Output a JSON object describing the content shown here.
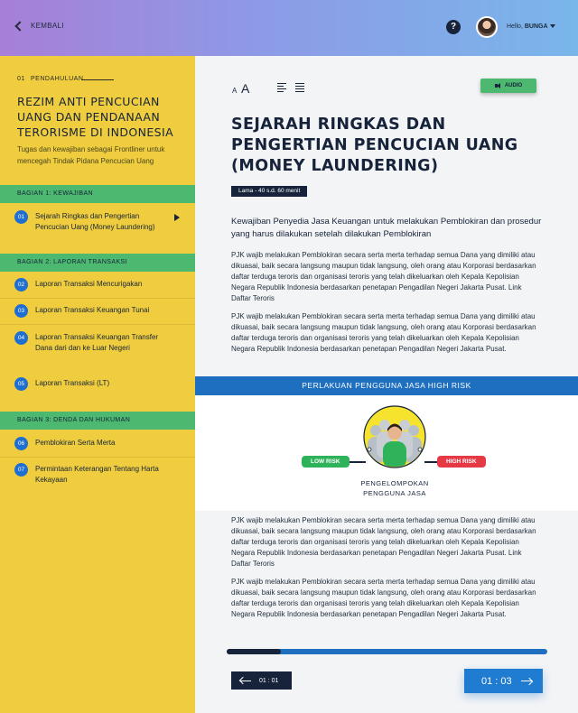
{
  "header": {
    "back_label": "KEMBALI",
    "help_glyph": "?",
    "greeting": "Hello,",
    "user_name": "BUNGA"
  },
  "sidebar": {
    "intro_number": "01",
    "intro_label": "PENDAHULUAN",
    "title": "REZIM ANTI PENCUCIAN UANG DAN PENDANAAN TERORISME DI INDONESIA",
    "subtitle": "Tugas dan kewajiban sebagai Frontliner untuk mencegah Tindak Pidana Pencucian Uang",
    "sections": [
      {
        "label": "BAGIAN 1: KEWAJIBAN",
        "items": [
          {
            "num": "01",
            "label": "Sejarah Ringkas dan Pengertian Pencucian Uang (Money Laundering)"
          }
        ]
      },
      {
        "label": "BAGIAN 2: LAPORAN TRANSAKSI",
        "items": [
          {
            "num": "02",
            "label": "Laporan Transaksi Mencurigakan"
          },
          {
            "num": "03",
            "label": "Laporan Transaksi Keuangan Tunai"
          },
          {
            "num": "04",
            "label": "Laporan Transaksi Keuangan Transfer Dana dari dan ke Luar Negeri"
          },
          {
            "num": "05",
            "label": "Laporan Transaksi (LT)"
          }
        ]
      },
      {
        "label": "BAGIAN 3: DENDA DAN HUKUMAN",
        "items": [
          {
            "num": "06",
            "label": "Pemblokiran Serta Merta"
          },
          {
            "num": "07",
            "label": "Permintaan Keterangan Tentang Harta Kekayaan"
          }
        ]
      }
    ]
  },
  "toolbar": {
    "font_small": "A",
    "font_large": "A",
    "audio_label": "AUDIO"
  },
  "content": {
    "title": "SEJARAH RINGKAS DAN PENGERTIAN PENCUCIAN UANG (MONEY LAUNDERING)",
    "duration": "Lama - 40 s.d. 60 menit",
    "lead": "Kewajiban Penyedia Jasa Keuangan untuk melakukan Pemblokiran dan prosedur yang harus dilakukan setelah dilakukan Pemblokiran",
    "paragraphs_top": [
      "PJK wajib melakukan Pemblokiran secara serta merta terhadap semua Dana yang dimiliki atau dikuasai, baik secara langsung maupun tidak langsung, oleh orang atau Korporasi berdasarkan daftar terduga teroris dan organisasi teroris yang telah dikeluarkan oleh Kepala Kepolisian Negara Republik Indonesia berdasarkan penetapan Pengadilan Negeri Jakarta Pusat. Link Daftar Teroris",
      "PJK wajib melakukan Pemblokiran secara serta merta terhadap semua Dana yang dimiliki atau dikuasai, baik secara langsung maupun tidak langsung, oleh orang atau Korporasi berdasarkan daftar terduga teroris dan organisasi teroris yang telah dikeluarkan oleh Kepala Kepolisian Negara Republik Indonesia berdasarkan penetapan Pengadilan Negeri Jakarta Pusat."
    ],
    "risk_band": "PERLAKUAN PENGGUNA JASA  HIGH RISK",
    "low_risk": "LOW RISK",
    "high_risk": "HIGH RISK",
    "group_label": "PENGELOMPOKAN PENGGUNA JASA",
    "paragraphs_bottom": [
      "PJK wajib melakukan Pemblokiran secara serta merta terhadap semua Dana yang dimiliki atau dikuasai, baik secara langsung maupun tidak langsung, oleh orang atau Korporasi berdasarkan daftar terduga teroris dan organisasi teroris  yang telah dikeluarkan oleh Kepala Kepolisian Negara Republik Indonesia berdasarkan penetapan Pengadilan Negeri Jakarta Pusat.  Link Daftar Teroris",
      "PJK wajib melakukan Pemblokiran secara serta merta terhadap semua Dana yang dimiliki atau dikuasai, baik secara langsung maupun tidak langsung, oleh orang atau Korporasi berdasarkan daftar terduga teroris dan organisasi teroris  yang telah dikeluarkan oleh Kepala Kepolisian Negara Republik Indonesia berdasarkan penetapan Pengadilan Negeri Jakarta Pusat."
    ]
  },
  "navigation": {
    "progress_fraction": 0.17,
    "prev_label": "01 : 01",
    "next_label": "01 : 03"
  },
  "colors": {
    "accent_blue": "#1f6fc0",
    "sidebar_yellow": "#efcd3e",
    "section_green": "#4cb870",
    "low_risk_green": "#2fb35a",
    "high_risk_red": "#e63946",
    "navy": "#16233a"
  }
}
